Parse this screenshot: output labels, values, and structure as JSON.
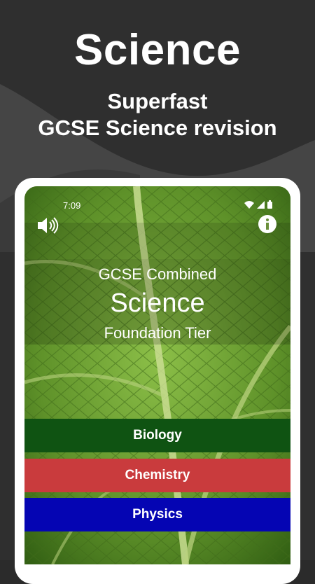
{
  "promo": {
    "title": "Science",
    "subtitle_line1": "Superfast",
    "subtitle_line2": "GCSE Science revision"
  },
  "status_bar": {
    "time": "7:09",
    "icons": [
      "wifi-icon",
      "signal-icon",
      "battery-icon"
    ]
  },
  "toolbar": {
    "sound_icon": "speaker-icon",
    "info_icon": "info-icon"
  },
  "header": {
    "line1": "GCSE Combined",
    "line2": "Science",
    "line3": "Foundation Tier"
  },
  "subjects": [
    {
      "label": "Biology",
      "color": "#0f5312"
    },
    {
      "label": "Chemistry",
      "color": "#c93b3d"
    },
    {
      "label": "Physics",
      "color": "#0505b3"
    }
  ]
}
